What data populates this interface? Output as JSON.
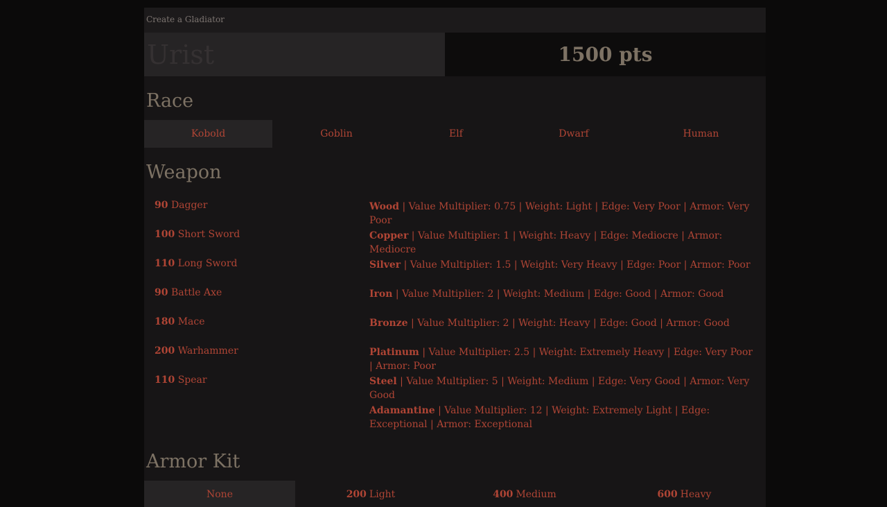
{
  "window": {
    "title": "Create a Gladiator"
  },
  "name_field": {
    "placeholder": "Urist",
    "value": ""
  },
  "points": {
    "label": "1500 pts"
  },
  "race": {
    "heading": "Race",
    "options": [
      "Kobold",
      "Goblin",
      "Elf",
      "Dwarf",
      "Human"
    ],
    "selected": "Kobold"
  },
  "weapon": {
    "heading": "Weapon",
    "items": [
      {
        "cost": "90",
        "name": "Dagger"
      },
      {
        "cost": "100",
        "name": "Short Sword"
      },
      {
        "cost": "110",
        "name": "Long Sword"
      },
      {
        "cost": "90",
        "name": "Battle Axe"
      },
      {
        "cost": "180",
        "name": "Mace"
      },
      {
        "cost": "200",
        "name": "Warhammer"
      },
      {
        "cost": "110",
        "name": "Spear"
      }
    ],
    "materials": [
      {
        "name": "Wood",
        "details": "| Value Multiplier: 0.75 | Weight: Light | Edge: Very Poor | Armor: Very Poor"
      },
      {
        "name": "Copper",
        "details": "| Value Multiplier: 1 | Weight: Heavy | Edge: Mediocre | Armor: Mediocre"
      },
      {
        "name": "Silver",
        "details": "| Value Multiplier: 1.5 | Weight: Very Heavy | Edge: Poor | Armor: Poor"
      },
      {
        "name": "Iron",
        "details": "| Value Multiplier: 2 | Weight: Medium | Edge: Good | Armor: Good"
      },
      {
        "name": "Bronze",
        "details": "| Value Multiplier: 2 | Weight: Heavy | Edge: Good | Armor: Good"
      },
      {
        "name": "Platinum",
        "details": "| Value Multiplier: 2.5 | Weight: Extremely Heavy | Edge: Very Poor | Armor: Poor"
      },
      {
        "name": "Steel",
        "details": "| Value Multiplier: 5 | Weight: Medium | Edge: Very Good | Armor: Very Good"
      },
      {
        "name": "Adamantine",
        "details": "| Value Multiplier: 12 | Weight: Extremely Light | Edge: Exceptional | Armor: Exceptional"
      }
    ]
  },
  "armor_kit": {
    "heading": "Armor Kit",
    "options": [
      {
        "cost": "",
        "name": "None"
      },
      {
        "cost": "200",
        "name": "Light"
      },
      {
        "cost": "400",
        "name": "Medium"
      },
      {
        "cost": "600",
        "name": "Heavy"
      }
    ],
    "selected": "None"
  },
  "colors": {
    "background": "#0b0a0a",
    "panel": "#171516",
    "accent_red": "#b04535",
    "heading_tan": "#7d7264"
  }
}
